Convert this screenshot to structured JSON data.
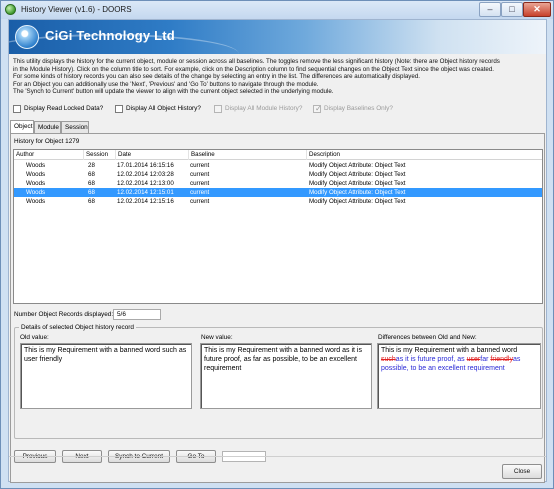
{
  "window": {
    "title": "History Viewer (v1.6)  -  DOORS",
    "controls": {
      "minimize": "–",
      "maximize": "□",
      "close": "✕"
    }
  },
  "banner": {
    "company": "CiGi Technology Ltd"
  },
  "intro": {
    "lines": [
      "This utility displays the history for the current object, module or session across all baselines. The toggles remove the less significant history (Note: there are Object history records",
      "in the Module History). Click on the column title to sort. For example, click on the Description column to find sequential changes on the Object Text since the object was created.",
      "For some kinds of history records you can also see details of the change by selecting an entry in the list. The differences are automatically displayed.",
      "For an Object you can additionally use the 'Next', 'Previous' and 'Go To' buttons to navigate through the module.",
      "The 'Synch to Current' button will update the viewer to align with the current object selected in the underlying module."
    ]
  },
  "options": {
    "read_locked": "Display Read Locked Data?",
    "all_object": "Display All Object History?",
    "all_module": "Display All Module History?",
    "baselines_only": "Display Baselines Only?"
  },
  "tabs": [
    "Object",
    "Module",
    "Session"
  ],
  "history": {
    "label": "History for Object 1279",
    "columns": [
      "Author",
      "Session",
      "Date",
      "Baseline",
      "Description"
    ],
    "rows": [
      [
        "Woods",
        "28",
        "17.01.2014 16:15:16",
        "current",
        "Modify Object Attribute: Object Text"
      ],
      [
        "Woods",
        "68",
        "12.02.2014 12:03:28",
        "current",
        "Modify Object Attribute: Object Text"
      ],
      [
        "Woods",
        "68",
        "12.02.2014 12:13:00",
        "current",
        "Modify Object Attribute: Object Text"
      ],
      [
        "Woods",
        "68",
        "12.02.2014 12:15:01",
        "current",
        "Modify Object Attribute: Object Text"
      ],
      [
        "Woods",
        "68",
        "12.02.2014 12:15:16",
        "current",
        "Modify Object Attribute: Object Text"
      ]
    ],
    "selected_row": 4
  },
  "records": {
    "label": "Number Object Records displayed:",
    "value": "5/6"
  },
  "details": {
    "legend": "Details of selected Object history record",
    "old_label": "Old value:",
    "new_label": "New value:",
    "diff_label": "Differences between Old and New:",
    "old_text": "This is my Requirement with a banned word such as user friendly",
    "new_text": "This is my Requirement with a banned word as it is future proof, as far as possible, to be an excellent requirement",
    "diff": {
      "prefix": "This is my Requirement with a banned word ",
      "del1": "such",
      "ins1": "as it is future proof, ",
      "mid": "as ",
      "del2": "user",
      "ins2": "far ",
      "del3": "friendly",
      "ins3": "as possible, to be an excellent requirement"
    },
    "colors": {
      "deleted": "#e02020",
      "inserted": "#2a2ad6"
    }
  },
  "buttons": {
    "previous": "Previous",
    "next": "Next",
    "synch": "Synch to Current",
    "goto": "Go To",
    "close": "Close"
  }
}
